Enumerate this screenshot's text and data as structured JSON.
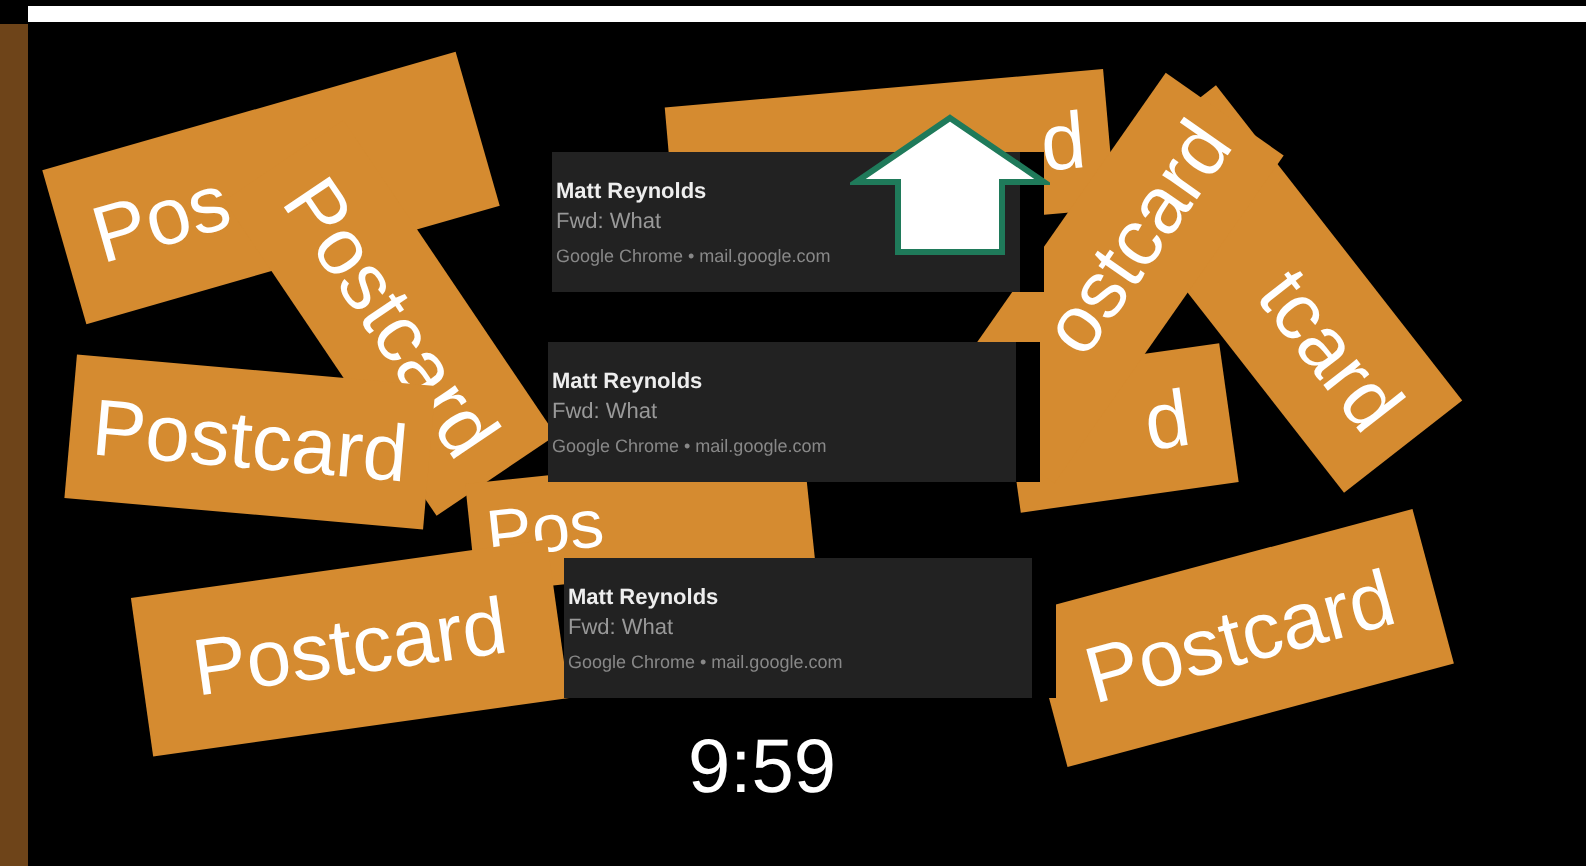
{
  "postcards": [
    {
      "text": "Pos"
    },
    {
      "text": "Postcard"
    },
    {
      "text": "Postcard"
    },
    {
      "text": "Pos"
    },
    {
      "text": "Postcard"
    },
    {
      "text": "d"
    },
    {
      "text": "tcard"
    },
    {
      "text": "d"
    },
    {
      "text": "ostcard"
    },
    {
      "text": "Postcard"
    }
  ],
  "notifications": [
    {
      "sender": "Matt Reynolds",
      "subject": "Fwd: What",
      "source": "Google Chrome • mail.google.com"
    },
    {
      "sender": "Matt Reynolds",
      "subject": "Fwd: What",
      "source": "Google Chrome • mail.google.com"
    },
    {
      "sender": "Matt Reynolds",
      "subject": "Fwd: What",
      "source": "Google Chrome • mail.google.com"
    }
  ],
  "clock": "9:59"
}
